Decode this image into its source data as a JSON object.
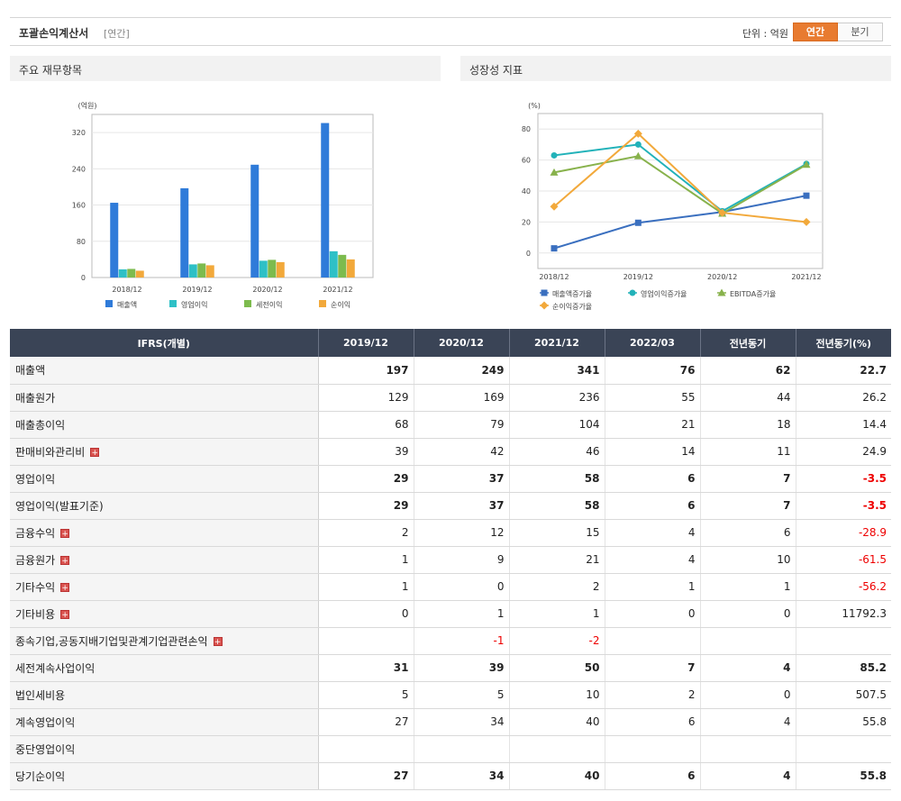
{
  "header": {
    "title": "포괄손익계산서",
    "period_tag": "[연간]",
    "unit_label": "단위 : 억원",
    "toggle_annual": "연간",
    "toggle_quarter": "분기"
  },
  "left_panel": {
    "title": "주요 재무항목",
    "unit": "(억원)"
  },
  "right_panel": {
    "title": "성장성 지표",
    "unit": "(%)"
  },
  "colors": {
    "sales": "#2f7bd9",
    "op": "#2ec0c6",
    "pretax": "#7dbb4e",
    "net": "#f2a93b",
    "accent": "#e87b30",
    "header_bg": "#3a4456",
    "neg": "#e00000",
    "g_sales": "#3a6fbf",
    "g_op": "#22b2b9",
    "g_ebitda": "#88b24c",
    "g_net": "#f2a93b"
  },
  "chart_data": [
    {
      "type": "bar",
      "categories": [
        "2018/12",
        "2019/12",
        "2020/12",
        "2021/12"
      ],
      "ylim": [
        0,
        360
      ],
      "yticks": [
        0,
        80,
        160,
        240,
        320
      ],
      "series": [
        {
          "name": "매출액",
          "values": [
            165,
            197,
            249,
            341
          ]
        },
        {
          "name": "영업이익",
          "values": [
            18,
            29,
            37,
            58
          ]
        },
        {
          "name": "세전이익",
          "values": [
            19,
            31,
            39,
            50
          ]
        },
        {
          "name": "순이익",
          "values": [
            15,
            27,
            34,
            40
          ]
        }
      ]
    },
    {
      "type": "line",
      "categories": [
        "2018/12",
        "2019/12",
        "2020/12",
        "2021/12"
      ],
      "ylim": [
        -10,
        90
      ],
      "yticks": [
        0,
        20,
        40,
        60,
        80
      ],
      "series": [
        {
          "name": "매출액증가율",
          "values": [
            3,
            19.5,
            26.5,
            37
          ]
        },
        {
          "name": "영업이익증가율",
          "values": [
            63,
            70,
            27,
            57.5
          ]
        },
        {
          "name": "EBITDA증가율",
          "values": [
            52,
            62.5,
            25.5,
            57
          ]
        },
        {
          "name": "순이익증가율",
          "values": [
            30,
            77,
            26,
            20
          ]
        }
      ]
    }
  ],
  "table": {
    "headers": [
      "IFRS(개별)",
      "2019/12",
      "2020/12",
      "2021/12",
      "2022/03",
      "전년동기",
      "전년동기(%)"
    ],
    "rows": [
      {
        "label": "매출액",
        "values": [
          "197",
          "249",
          "341",
          "76",
          "62",
          "22.7"
        ]
      },
      {
        "label": "매출원가",
        "values": [
          "129",
          "169",
          "236",
          "55",
          "44",
          "26.2"
        ]
      },
      {
        "label": "매출총이익",
        "values": [
          "68",
          "79",
          "104",
          "21",
          "18",
          "14.4"
        ]
      },
      {
        "label": "판매비와관리비",
        "values": [
          "39",
          "42",
          "46",
          "14",
          "11",
          "24.9"
        ]
      },
      {
        "label": "영업이익",
        "values": [
          "29",
          "37",
          "58",
          "6",
          "7",
          "-3.5"
        ]
      },
      {
        "label": "영업이익(발표기준)",
        "values": [
          "29",
          "37",
          "58",
          "6",
          "7",
          "-3.5"
        ]
      },
      {
        "label": "금융수익",
        "values": [
          "2",
          "12",
          "15",
          "4",
          "6",
          "-28.9"
        ]
      },
      {
        "label": "금융원가",
        "values": [
          "1",
          "9",
          "21",
          "4",
          "10",
          "-61.5"
        ]
      },
      {
        "label": "기타수익",
        "values": [
          "1",
          "0",
          "2",
          "1",
          "1",
          "-56.2"
        ]
      },
      {
        "label": "기타비용",
        "values": [
          "0",
          "1",
          "1",
          "0",
          "0",
          "11792.3"
        ]
      },
      {
        "label": "종속기업,공동지배기업및관계기업관련손익",
        "values": [
          "",
          "-1",
          "-2",
          "",
          "",
          ""
        ]
      },
      {
        "label": "세전계속사업이익",
        "values": [
          "31",
          "39",
          "50",
          "7",
          "4",
          "85.2"
        ]
      },
      {
        "label": "법인세비용",
        "values": [
          "5",
          "5",
          "10",
          "2",
          "0",
          "507.5"
        ]
      },
      {
        "label": "계속영업이익",
        "values": [
          "27",
          "34",
          "40",
          "6",
          "4",
          "55.8"
        ]
      },
      {
        "label": "중단영업이익",
        "values": [
          "",
          "",
          "",
          "",
          "",
          ""
        ]
      },
      {
        "label": "당기순이익",
        "values": [
          "27",
          "34",
          "40",
          "6",
          "4",
          "55.8"
        ]
      }
    ]
  }
}
